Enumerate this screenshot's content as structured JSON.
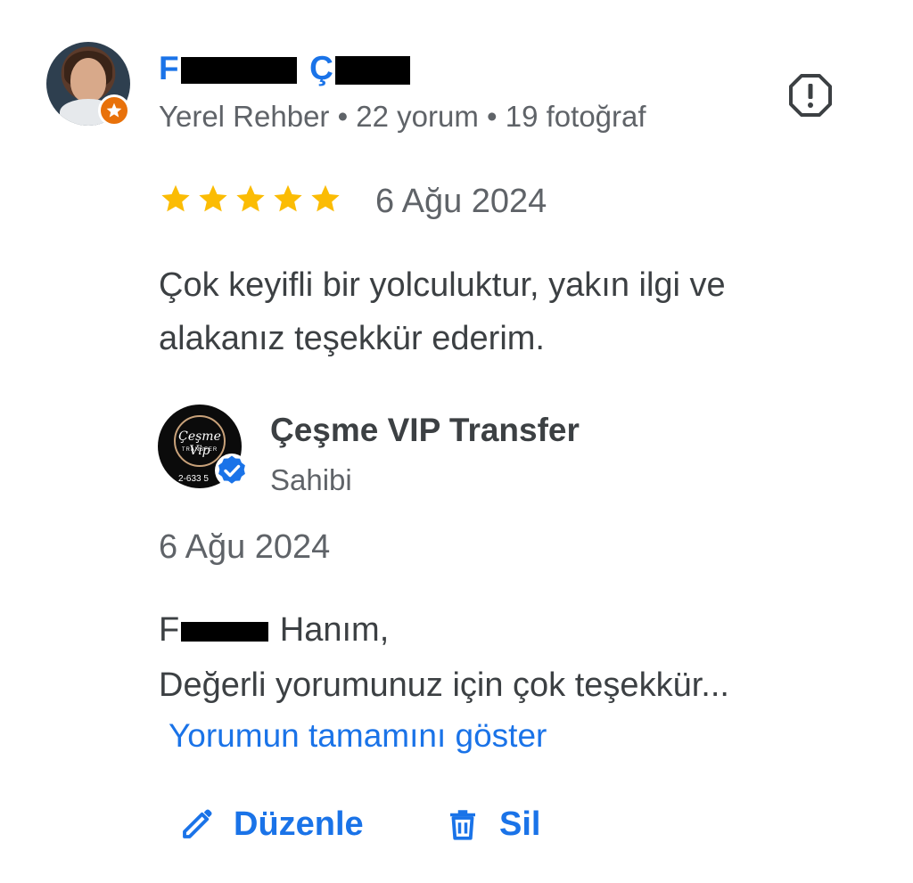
{
  "review": {
    "reviewer": {
      "name_prefix": "F",
      "name_mid": "Ç",
      "meta": "Yerel Rehber • 22 yorum • 19 fotoğraf",
      "avatar_icon": "user-avatar",
      "badge_icon": "local-guide-star-icon"
    },
    "report_icon": "report-icon",
    "rating": 5,
    "rating_max": 5,
    "date": "6 Ağu 2024",
    "text": "Çok keyifli bir yolculuktur, yakın ilgi ve alakanız teşekkür ederim."
  },
  "reply": {
    "owner_name": "Çeşme VIP Transfer",
    "owner_role": "Sahibi",
    "logo_script": "Çeşme Vip",
    "logo_sub": "TRANSFER",
    "logo_phone": "2-633 5",
    "verified_icon": "verified-check-icon",
    "date": "6 Ağu 2024",
    "greeting_prefix": "F",
    "greeting_suffix": " Hanım,",
    "text_line2": "Değerli yorumunuz için çok teşekkür...",
    "show_more": "Yorumun tamamını göster"
  },
  "actions": {
    "edit_label": "Düzenle",
    "edit_icon": "pencil-icon",
    "delete_label": "Sil",
    "delete_icon": "trash-icon"
  },
  "colors": {
    "accent": "#1a73e8",
    "star": "#fbbc04",
    "text": "#3c4043",
    "muted": "#5f6368",
    "guide_badge": "#e8710a"
  }
}
